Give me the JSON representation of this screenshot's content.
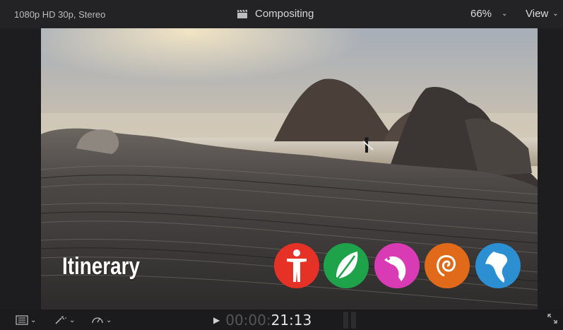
{
  "topbar": {
    "format": "1080p HD 30p, Stereo",
    "project_name": "Compositing",
    "zoom": "66%",
    "view_label": "View"
  },
  "viewer": {
    "title_text": "Itinerary",
    "logos": [
      {
        "name": "person",
        "color": "#e63127"
      },
      {
        "name": "leaf",
        "color": "#1fa34a"
      },
      {
        "name": "bird",
        "color": "#d93bb4"
      },
      {
        "name": "spiral",
        "color": "#e06a1a"
      },
      {
        "name": "globe",
        "color": "#2b8fd1"
      }
    ]
  },
  "playback": {
    "timecode_dim": "00:00:",
    "timecode_bright": "21:13"
  },
  "icons": {
    "layout": "clip-layout-icon",
    "transform": "transform-tool-icon",
    "speed": "retime-speed-icon",
    "play": "play-icon",
    "fullscreen": "fullscreen-icon"
  }
}
